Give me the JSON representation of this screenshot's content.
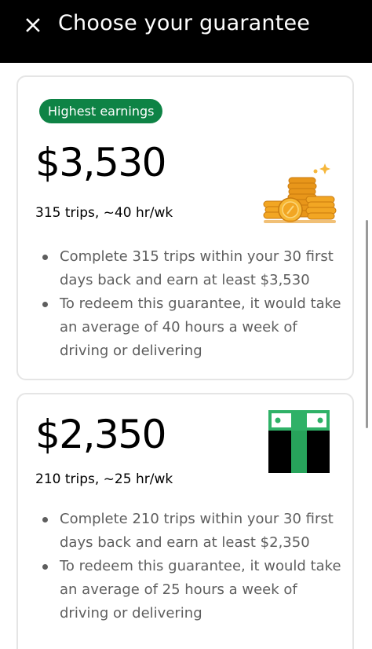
{
  "header": {
    "title": "Choose your guarantee"
  },
  "guarantees": [
    {
      "badge": "Highest earnings",
      "amount": "$3,530",
      "subtitle": "315 trips, ~40 hr/wk",
      "bullets": [
        "Complete 315 trips within your 30 first days back and earn at least $3,530",
        "To redeem this guarantee, it would take an average of 40 hours a week of driving or delivering"
      ],
      "illustration": "gold-coins-icon"
    },
    {
      "amount": "$2,350",
      "subtitle": "210 trips, ~25 hr/wk",
      "bullets": [
        "Complete 210 trips within your 30 first days back and earn at least $2,350",
        "To redeem this guarantee, it would take an average of 25 hours a week of driving or delivering"
      ],
      "illustration": "cash-stack-icon"
    }
  ],
  "colors": {
    "header_bg": "#000000",
    "badge_green": "#0e8345",
    "coin_gold": "#f2a623",
    "cash_green": "#2fb167"
  }
}
